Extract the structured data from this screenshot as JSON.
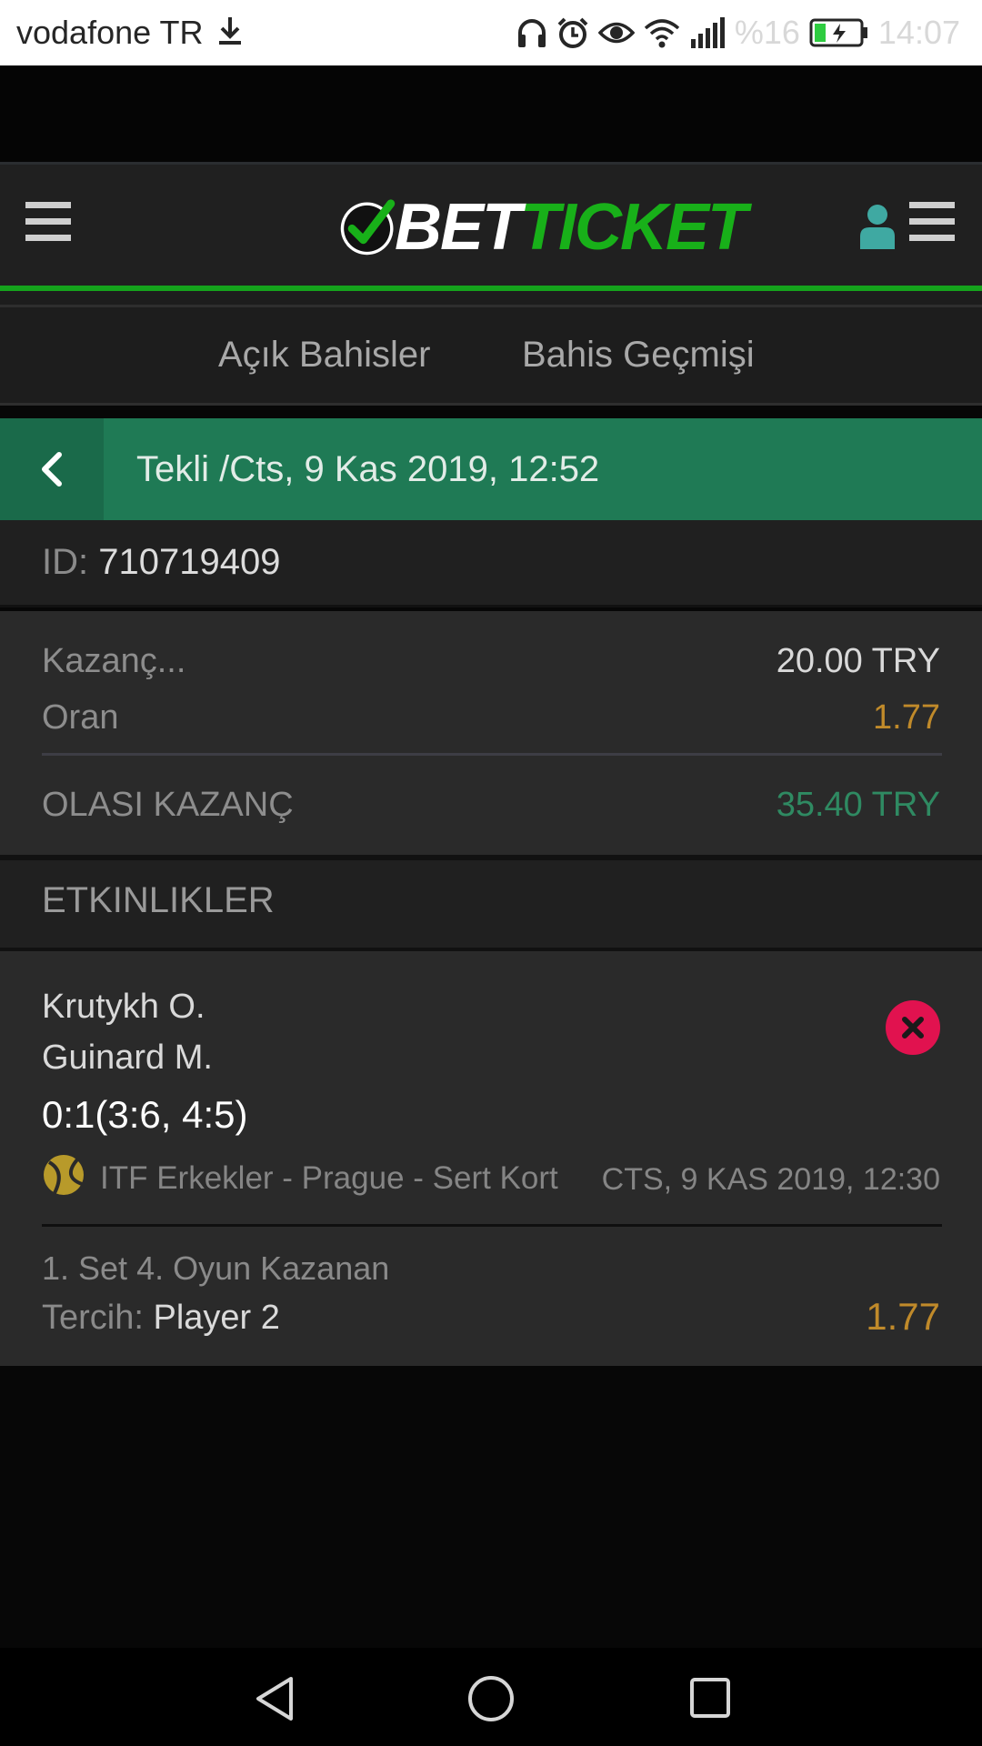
{
  "status_bar": {
    "carrier": "vodafone TR",
    "battery": "%16",
    "time": "14:07"
  },
  "header": {
    "logo_bet": "BET",
    "logo_ticket": "TICKET"
  },
  "tabs": [
    {
      "label": "Açık Bahisler"
    },
    {
      "label": "Bahis Geçmişi"
    }
  ],
  "bet": {
    "title": "Tekli /Cts, 9 Kas 2019, 12:52",
    "id_label": "ID:",
    "id_value": "710719409",
    "stake_label": "Kazanç...",
    "stake_value": "20.00 TRY",
    "odds_label": "Oran",
    "odds_value": "1.77",
    "potential_label": "OLASI KAZANÇ",
    "potential_value": "35.40 TRY"
  },
  "events_section": {
    "title": "ETKINLIKLER"
  },
  "event": {
    "team1": "Krutykh O.",
    "team2": "Guinard M.",
    "score": "0:1(3:6, 4:5)",
    "league": "ITF Erkekler - Prague - Sert Kort",
    "date": "CTS, 9 KAS 2019, 12:30",
    "market": "1. Set 4. Oyun Kazanan",
    "choice_label": "Tercih:",
    "choice_value": "Player 2",
    "choice_odds": "1.77"
  },
  "colors": {
    "accent_green": "#18b019",
    "bar_green": "#1f7a55",
    "odds_gold": "#c08a2a",
    "potential_green": "#2f8a62",
    "close_red": "#e1124f"
  }
}
